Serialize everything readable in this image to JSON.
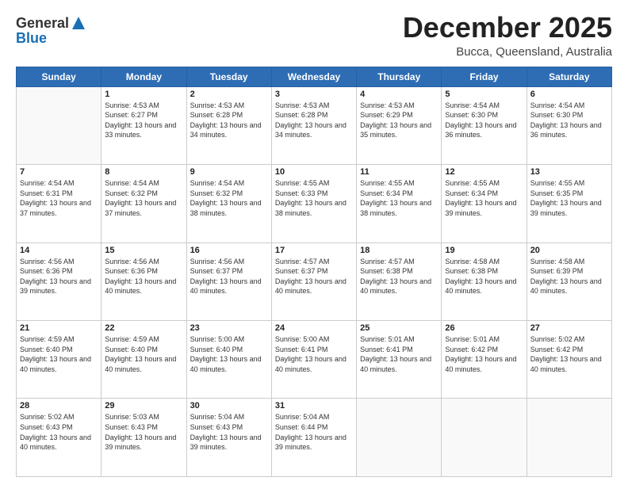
{
  "header": {
    "logo_line1": "General",
    "logo_line2": "Blue",
    "month_title": "December 2025",
    "location": "Bucca, Queensland, Australia"
  },
  "days_of_week": [
    "Sunday",
    "Monday",
    "Tuesday",
    "Wednesday",
    "Thursday",
    "Friday",
    "Saturday"
  ],
  "weeks": [
    [
      {
        "day": "",
        "sunrise": "",
        "sunset": "",
        "daylight": ""
      },
      {
        "day": "1",
        "sunrise": "Sunrise: 4:53 AM",
        "sunset": "Sunset: 6:27 PM",
        "daylight": "Daylight: 13 hours and 33 minutes."
      },
      {
        "day": "2",
        "sunrise": "Sunrise: 4:53 AM",
        "sunset": "Sunset: 6:28 PM",
        "daylight": "Daylight: 13 hours and 34 minutes."
      },
      {
        "day": "3",
        "sunrise": "Sunrise: 4:53 AM",
        "sunset": "Sunset: 6:28 PM",
        "daylight": "Daylight: 13 hours and 34 minutes."
      },
      {
        "day": "4",
        "sunrise": "Sunrise: 4:53 AM",
        "sunset": "Sunset: 6:29 PM",
        "daylight": "Daylight: 13 hours and 35 minutes."
      },
      {
        "day": "5",
        "sunrise": "Sunrise: 4:54 AM",
        "sunset": "Sunset: 6:30 PM",
        "daylight": "Daylight: 13 hours and 36 minutes."
      },
      {
        "day": "6",
        "sunrise": "Sunrise: 4:54 AM",
        "sunset": "Sunset: 6:30 PM",
        "daylight": "Daylight: 13 hours and 36 minutes."
      }
    ],
    [
      {
        "day": "7",
        "sunrise": "Sunrise: 4:54 AM",
        "sunset": "Sunset: 6:31 PM",
        "daylight": "Daylight: 13 hours and 37 minutes."
      },
      {
        "day": "8",
        "sunrise": "Sunrise: 4:54 AM",
        "sunset": "Sunset: 6:32 PM",
        "daylight": "Daylight: 13 hours and 37 minutes."
      },
      {
        "day": "9",
        "sunrise": "Sunrise: 4:54 AM",
        "sunset": "Sunset: 6:32 PM",
        "daylight": "Daylight: 13 hours and 38 minutes."
      },
      {
        "day": "10",
        "sunrise": "Sunrise: 4:55 AM",
        "sunset": "Sunset: 6:33 PM",
        "daylight": "Daylight: 13 hours and 38 minutes."
      },
      {
        "day": "11",
        "sunrise": "Sunrise: 4:55 AM",
        "sunset": "Sunset: 6:34 PM",
        "daylight": "Daylight: 13 hours and 38 minutes."
      },
      {
        "day": "12",
        "sunrise": "Sunrise: 4:55 AM",
        "sunset": "Sunset: 6:34 PM",
        "daylight": "Daylight: 13 hours and 39 minutes."
      },
      {
        "day": "13",
        "sunrise": "Sunrise: 4:55 AM",
        "sunset": "Sunset: 6:35 PM",
        "daylight": "Daylight: 13 hours and 39 minutes."
      }
    ],
    [
      {
        "day": "14",
        "sunrise": "Sunrise: 4:56 AM",
        "sunset": "Sunset: 6:36 PM",
        "daylight": "Daylight: 13 hours and 39 minutes."
      },
      {
        "day": "15",
        "sunrise": "Sunrise: 4:56 AM",
        "sunset": "Sunset: 6:36 PM",
        "daylight": "Daylight: 13 hours and 40 minutes."
      },
      {
        "day": "16",
        "sunrise": "Sunrise: 4:56 AM",
        "sunset": "Sunset: 6:37 PM",
        "daylight": "Daylight: 13 hours and 40 minutes."
      },
      {
        "day": "17",
        "sunrise": "Sunrise: 4:57 AM",
        "sunset": "Sunset: 6:37 PM",
        "daylight": "Daylight: 13 hours and 40 minutes."
      },
      {
        "day": "18",
        "sunrise": "Sunrise: 4:57 AM",
        "sunset": "Sunset: 6:38 PM",
        "daylight": "Daylight: 13 hours and 40 minutes."
      },
      {
        "day": "19",
        "sunrise": "Sunrise: 4:58 AM",
        "sunset": "Sunset: 6:38 PM",
        "daylight": "Daylight: 13 hours and 40 minutes."
      },
      {
        "day": "20",
        "sunrise": "Sunrise: 4:58 AM",
        "sunset": "Sunset: 6:39 PM",
        "daylight": "Daylight: 13 hours and 40 minutes."
      }
    ],
    [
      {
        "day": "21",
        "sunrise": "Sunrise: 4:59 AM",
        "sunset": "Sunset: 6:40 PM",
        "daylight": "Daylight: 13 hours and 40 minutes."
      },
      {
        "day": "22",
        "sunrise": "Sunrise: 4:59 AM",
        "sunset": "Sunset: 6:40 PM",
        "daylight": "Daylight: 13 hours and 40 minutes."
      },
      {
        "day": "23",
        "sunrise": "Sunrise: 5:00 AM",
        "sunset": "Sunset: 6:40 PM",
        "daylight": "Daylight: 13 hours and 40 minutes."
      },
      {
        "day": "24",
        "sunrise": "Sunrise: 5:00 AM",
        "sunset": "Sunset: 6:41 PM",
        "daylight": "Daylight: 13 hours and 40 minutes."
      },
      {
        "day": "25",
        "sunrise": "Sunrise: 5:01 AM",
        "sunset": "Sunset: 6:41 PM",
        "daylight": "Daylight: 13 hours and 40 minutes."
      },
      {
        "day": "26",
        "sunrise": "Sunrise: 5:01 AM",
        "sunset": "Sunset: 6:42 PM",
        "daylight": "Daylight: 13 hours and 40 minutes."
      },
      {
        "day": "27",
        "sunrise": "Sunrise: 5:02 AM",
        "sunset": "Sunset: 6:42 PM",
        "daylight": "Daylight: 13 hours and 40 minutes."
      }
    ],
    [
      {
        "day": "28",
        "sunrise": "Sunrise: 5:02 AM",
        "sunset": "Sunset: 6:43 PM",
        "daylight": "Daylight: 13 hours and 40 minutes."
      },
      {
        "day": "29",
        "sunrise": "Sunrise: 5:03 AM",
        "sunset": "Sunset: 6:43 PM",
        "daylight": "Daylight: 13 hours and 39 minutes."
      },
      {
        "day": "30",
        "sunrise": "Sunrise: 5:04 AM",
        "sunset": "Sunset: 6:43 PM",
        "daylight": "Daylight: 13 hours and 39 minutes."
      },
      {
        "day": "31",
        "sunrise": "Sunrise: 5:04 AM",
        "sunset": "Sunset: 6:44 PM",
        "daylight": "Daylight: 13 hours and 39 minutes."
      },
      {
        "day": "",
        "sunrise": "",
        "sunset": "",
        "daylight": ""
      },
      {
        "day": "",
        "sunrise": "",
        "sunset": "",
        "daylight": ""
      },
      {
        "day": "",
        "sunrise": "",
        "sunset": "",
        "daylight": ""
      }
    ]
  ]
}
